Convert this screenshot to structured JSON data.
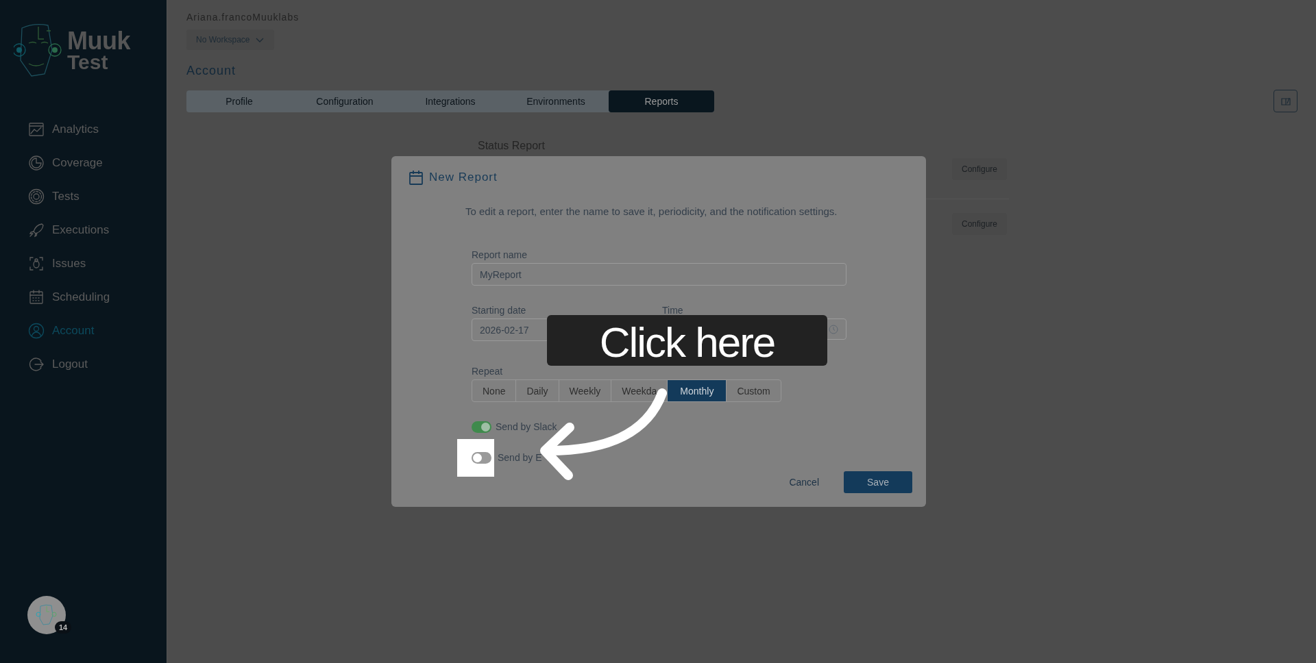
{
  "sidebar": {
    "logo": {
      "line_1": "Muuk",
      "line_2": "Test"
    },
    "items": [
      {
        "label": "Analytics",
        "selected": false
      },
      {
        "label": "Coverage",
        "selected": false
      },
      {
        "label": "Tests",
        "selected": false
      },
      {
        "label": "Executions",
        "selected": false
      },
      {
        "label": "Issues",
        "selected": false
      },
      {
        "label": "Scheduling",
        "selected": false
      },
      {
        "label": "Account",
        "selected": true
      },
      {
        "label": "Logout",
        "selected": false
      }
    ],
    "avatar": {
      "badge": "14"
    }
  },
  "header": {
    "user": "Ariana.francoMuuklabs",
    "workspace": "No Workspace",
    "title": "Account"
  },
  "tabs": [
    {
      "label": "Profile",
      "selected": false
    },
    {
      "label": "Configuration",
      "selected": false
    },
    {
      "label": "Integrations",
      "selected": false
    },
    {
      "label": "Environments",
      "selected": false
    },
    {
      "label": "Reports",
      "selected": true
    }
  ],
  "reports": [
    {
      "title": "Status Report",
      "action": "Configure"
    },
    {
      "action": "Configure"
    }
  ],
  "dialog": {
    "title": "New Report",
    "description": "To edit a report, enter the name to save it, periodicity, and the notification settings.",
    "report_name": {
      "label": "Report name",
      "value": "MyReport"
    },
    "starting_date": {
      "label": "Starting date",
      "value": "2026-02-17"
    },
    "time": {
      "label": "Time"
    },
    "repeat": {
      "label": "Repeat",
      "options": [
        {
          "label": "None",
          "selected": false
        },
        {
          "label": "Daily",
          "selected": false
        },
        {
          "label": "Weekly",
          "selected": false
        },
        {
          "label": "Weekda",
          "selected": false
        },
        {
          "label": "Monthly",
          "selected": true
        },
        {
          "label": "Custom",
          "selected": false
        }
      ]
    },
    "toggles": [
      {
        "label": "Send by Slack",
        "on": true,
        "highlighted": false
      },
      {
        "label": "Send by E",
        "on": false,
        "highlighted": true
      }
    ],
    "cancel": "Cancel",
    "save": "Save"
  },
  "callout": {
    "text": "Click here"
  }
}
